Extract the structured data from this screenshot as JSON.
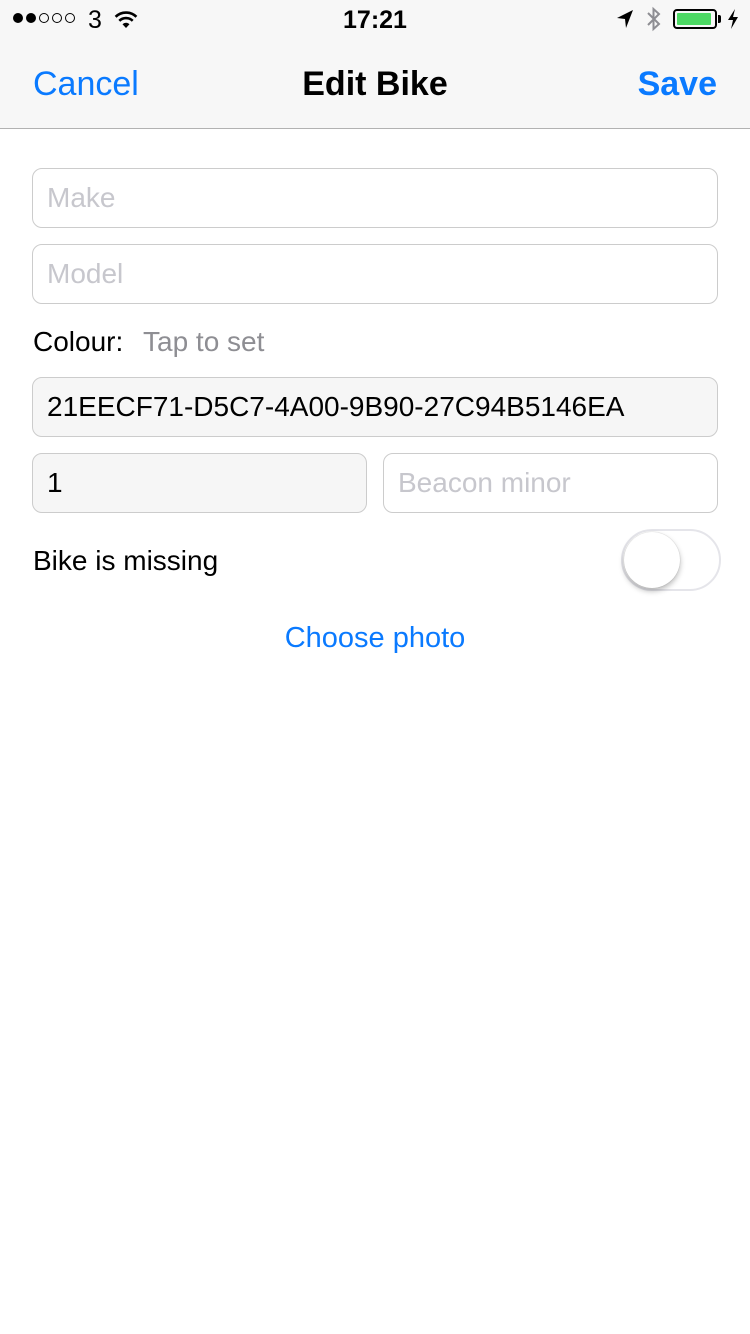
{
  "status_bar": {
    "signal_dots_filled": 2,
    "signal_dots_total": 5,
    "carrier": "3",
    "time": "17:21",
    "icons": [
      "wifi-icon",
      "location-arrow-icon",
      "bluetooth-icon",
      "battery-icon",
      "charging-bolt-icon"
    ],
    "battery_level": 0.95,
    "battery_color": "#4cd964"
  },
  "nav": {
    "cancel_label": "Cancel",
    "title": "Edit Bike",
    "save_label": "Save"
  },
  "form": {
    "make": {
      "value": "",
      "placeholder": "Make"
    },
    "model": {
      "value": "",
      "placeholder": "Model"
    },
    "colour_label": "Colour:",
    "colour_value": "Tap to set",
    "beacon_uuid": {
      "value": "21EECF71-D5C7-4A00-9B90-27C94B5146EA"
    },
    "beacon_major": {
      "value": "1"
    },
    "beacon_minor": {
      "value": "",
      "placeholder": "Beacon minor"
    },
    "missing_label": "Bike is missing",
    "missing_on": false,
    "choose_photo_label": "Choose photo"
  },
  "colors": {
    "accent": "#0a7aff",
    "bar_background": "#f7f7f7",
    "placeholder": "#c7c7cd",
    "secondary_text": "#8e8e93"
  }
}
